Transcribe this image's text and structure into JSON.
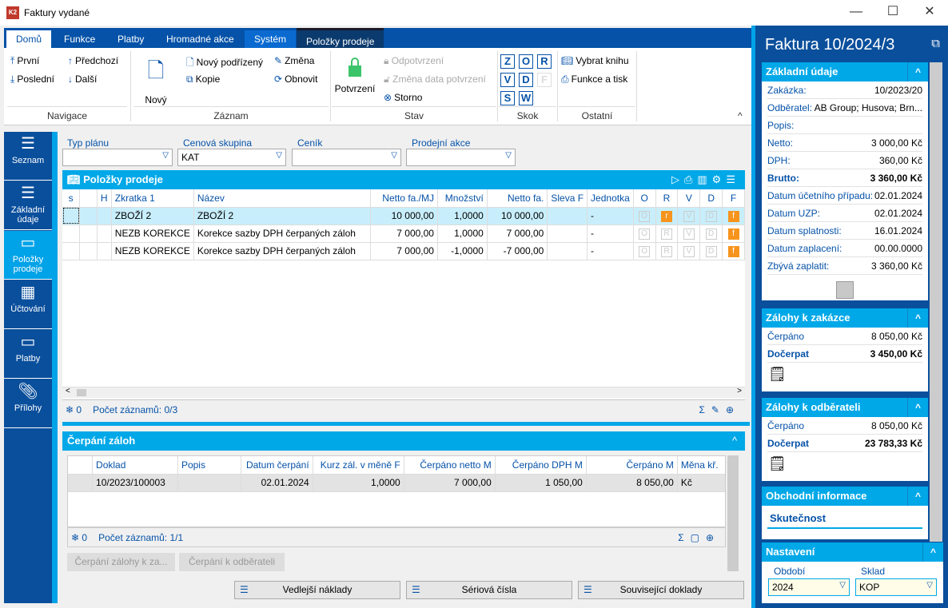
{
  "window": {
    "title": "Faktury vydané",
    "app_icon": "K2"
  },
  "ribbon": {
    "tabs": [
      "Domů",
      "Funkce",
      "Platby",
      "Hromadné akce",
      "Systém",
      "Položky prodeje"
    ],
    "navigace": {
      "label": "Navigace",
      "first": "První",
      "prev": "Předchozí",
      "last": "Poslední",
      "next": "Další"
    },
    "zaznam": {
      "label": "Záznam",
      "new": "Nový",
      "new_child": "Nový podřízený",
      "copy": "Kopie",
      "change": "Změna",
      "refresh": "Obnovit"
    },
    "stav": {
      "label": "Stav",
      "confirm": "Potvrzení",
      "unconfirm": "Odpotvrzení",
      "change_date": "Změna data potvrzení",
      "storno": "Storno"
    },
    "skok": {
      "label": "Skok",
      "keys": [
        "Z",
        "O",
        "R",
        "V",
        "D",
        "F",
        "S",
        "W"
      ]
    },
    "ostatni": {
      "label": "Ostatní",
      "choose_book": "Vybrat knihu",
      "print": "Funkce a tisk"
    }
  },
  "sidebar": {
    "items": [
      {
        "label": "Seznam",
        "icon": "list-icon"
      },
      {
        "label": "Základní údaje",
        "icon": "list-bullets-icon"
      },
      {
        "label": "Položky prodeje",
        "icon": "box-icon",
        "active": true
      },
      {
        "label": "Účtování",
        "icon": "calculator-icon"
      },
      {
        "label": "Platby",
        "icon": "box-icon"
      },
      {
        "label": "Přílohy",
        "icon": "paperclip-icon"
      }
    ]
  },
  "filters": {
    "typ_planu": {
      "label": "Typ plánu",
      "value": ""
    },
    "cenova_skupina": {
      "label": "Cenová skupina",
      "value": "KAT"
    },
    "cenik": {
      "label": "Ceník",
      "value": ""
    },
    "prodejni_akce": {
      "label": "Prodejní akce",
      "value": ""
    }
  },
  "items_grid": {
    "title": "Položky prodeje",
    "columns": [
      "s",
      "",
      "H",
      "Zkratka 1",
      "Název",
      "Netto fa./MJ",
      "Množství",
      "Netto fa.",
      "Sleva F",
      "Jednotka",
      "O",
      "R",
      "V",
      "D",
      "F"
    ],
    "rows": [
      {
        "zkratka": "ZBOŽÍ 2",
        "nazev": "ZBOŽÍ 2",
        "netto_mj": "10 000,00",
        "mnozstvi": "1,0000",
        "netto": "10 000,00",
        "sleva": "",
        "jednotka": "-",
        "flags": [
          "O",
          "r",
          "V",
          "D",
          "f"
        ],
        "flags_on": [
          false,
          true,
          false,
          false,
          true
        ]
      },
      {
        "zkratka": "NEZB KOREKCE",
        "nazev": "Korekce sazby DPH čerpaných záloh",
        "netto_mj": "7 000,00",
        "mnozstvi": "1,0000",
        "netto": "7 000,00",
        "sleva": "",
        "jednotka": "-",
        "flags": [
          "O",
          "R",
          "V",
          "D",
          "f"
        ],
        "flags_on": [
          false,
          false,
          false,
          false,
          true
        ]
      },
      {
        "zkratka": "NEZB KOREKCE",
        "nazev": "Korekce sazby DPH čerpaných záloh",
        "netto_mj": "7 000,00",
        "mnozstvi": "-1,0000",
        "netto": "-7 000,00",
        "sleva": "",
        "jednotka": "-",
        "flags": [
          "O",
          "R",
          "V",
          "D",
          "f"
        ],
        "flags_on": [
          false,
          false,
          false,
          false,
          true
        ]
      }
    ],
    "footer": {
      "selected": "0",
      "count": "Počet záznamů: 0/3"
    }
  },
  "advances_grid": {
    "title": "Čerpání záloh",
    "columns": [
      "",
      "Doklad",
      "Popis",
      "Datum čerpání",
      "Kurz zál. v měně F",
      "Čerpáno netto M",
      "Čerpáno DPH M",
      "Čerpáno M",
      "Měna kř."
    ],
    "rows": [
      [
        "",
        "10/2023/100003",
        "",
        "02.01.2024",
        "1,0000",
        "7 000,00",
        "1 050,00",
        "8 050,00",
        "Kč"
      ]
    ],
    "footer": {
      "selected": "0",
      "count": "Počet záznamů: 1/1"
    },
    "buttons": [
      "Čerpání zálohy k za...",
      "Čerpání k odběrateli"
    ]
  },
  "bottom_buttons": [
    "Vedlejší náklady",
    "Sériová čísla",
    "Související doklady"
  ],
  "right_panel": {
    "title": "Faktura 10/2024/3",
    "zakladni": {
      "title": "Základní údaje",
      "rows": [
        [
          "Zakázka:",
          "10/2023/20"
        ],
        [
          "Odběratel:",
          "AB Group; Husova; Brn..."
        ],
        [
          "Popis:",
          ""
        ],
        [
          "Netto:",
          "3 000,00 Kč"
        ],
        [
          "DPH:",
          "360,00 Kč"
        ],
        [
          "Brutto:",
          "3 360,00 Kč"
        ],
        [
          "Datum účetního případu:",
          "02.01.2024"
        ],
        [
          "Datum UZP:",
          "02.01.2024"
        ],
        [
          "Datum splatnosti:",
          "16.01.2024"
        ],
        [
          "Datum zaplacení:",
          "00.00.0000"
        ],
        [
          "Zbývá zaplatit:",
          "3 360,00 Kč"
        ]
      ]
    },
    "zakazka": {
      "title": "Zálohy k zakázce",
      "cerpano_label": "Čerpáno",
      "cerpano": "8 050,00 Kč",
      "docerpat_label": "Dočerpat",
      "docerpat": "3 450,00 Kč"
    },
    "odberatel": {
      "title": "Zálohy k odběrateli",
      "cerpano_label": "Čerpáno",
      "cerpano": "8 050,00 Kč",
      "docerpat_label": "Dočerpat",
      "docerpat": "23 783,33 Kč"
    },
    "obchodni": {
      "title": "Obchodní informace",
      "sub": "Skutečnost"
    },
    "nastaveni": {
      "title": "Nastavení",
      "obdobi_label": "Období",
      "obdobi": "2024",
      "sklad_label": "Sklad",
      "sklad": "KOP"
    }
  },
  "colors": {
    "dark_blue": "#0a4f9c",
    "accent": "#00a8e8",
    "flag": "#f7941d",
    "confirm": "#3cc46a"
  }
}
